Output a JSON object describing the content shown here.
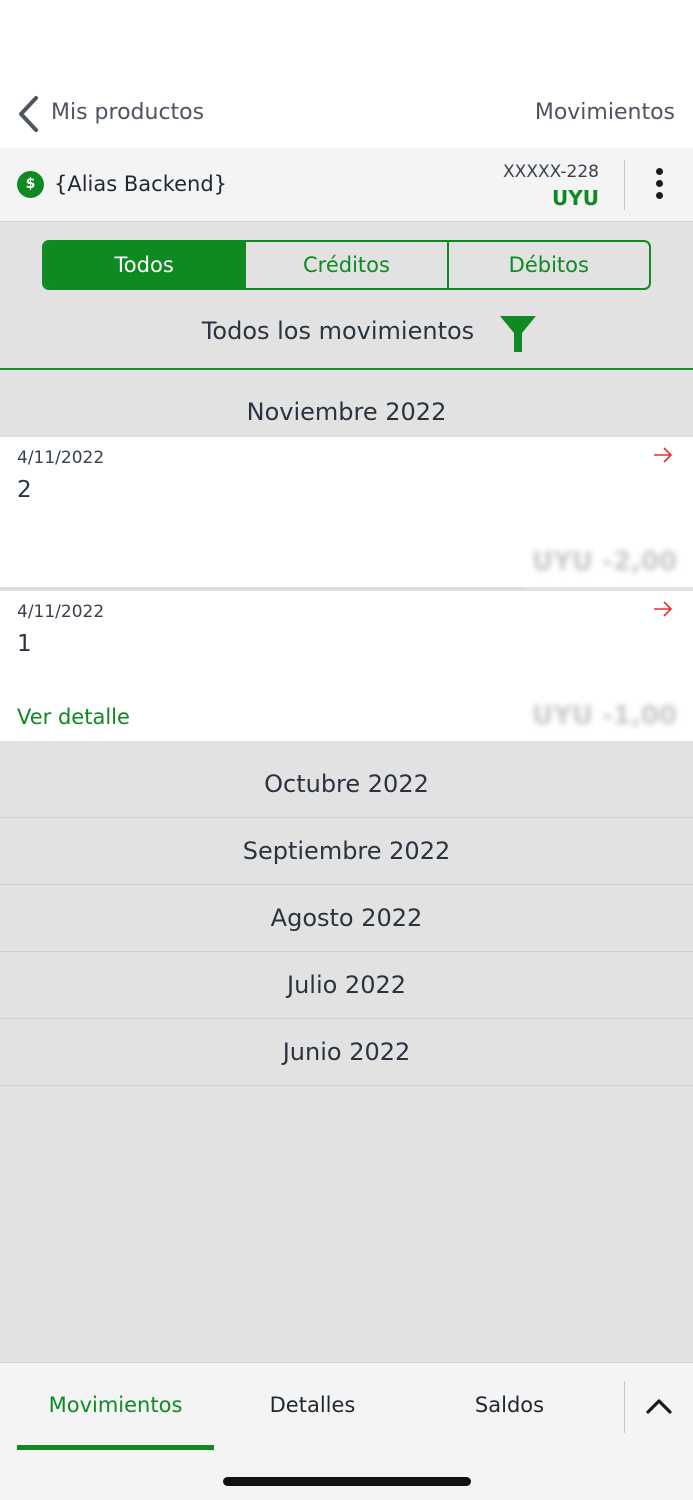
{
  "nav": {
    "back_label": "Mis productos",
    "title": "Movimientos"
  },
  "account": {
    "currency_icon": "$",
    "alias": "{Alias Backend}",
    "number": "XXXXX-228",
    "currency": "UYU"
  },
  "segments": [
    {
      "label": "Todos",
      "active": true
    },
    {
      "label": "Créditos",
      "active": false
    },
    {
      "label": "Débitos",
      "active": false
    }
  ],
  "filter": {
    "label": "Todos los movimientos"
  },
  "months": [
    {
      "label": "Noviembre 2022",
      "expanded": true
    },
    {
      "label": "Octubre 2022"
    },
    {
      "label": "Septiembre 2022"
    },
    {
      "label": "Agosto 2022"
    },
    {
      "label": "Julio 2022"
    },
    {
      "label": "Junio 2022"
    }
  ],
  "transactions": [
    {
      "date": "4/11/2022",
      "description": "2",
      "amount": "UYU -2,00"
    },
    {
      "date": "4/11/2022",
      "description": "1",
      "amount": "UYU -1,00",
      "detail_link": "Ver detalle"
    }
  ],
  "bottom_tabs": [
    {
      "label": "Movimientos",
      "active": true
    },
    {
      "label": "Detalles",
      "active": false
    },
    {
      "label": "Saldos",
      "active": false
    }
  ],
  "colors": {
    "accent": "#0f8a23",
    "outgoing_arrow": "#e03030"
  }
}
